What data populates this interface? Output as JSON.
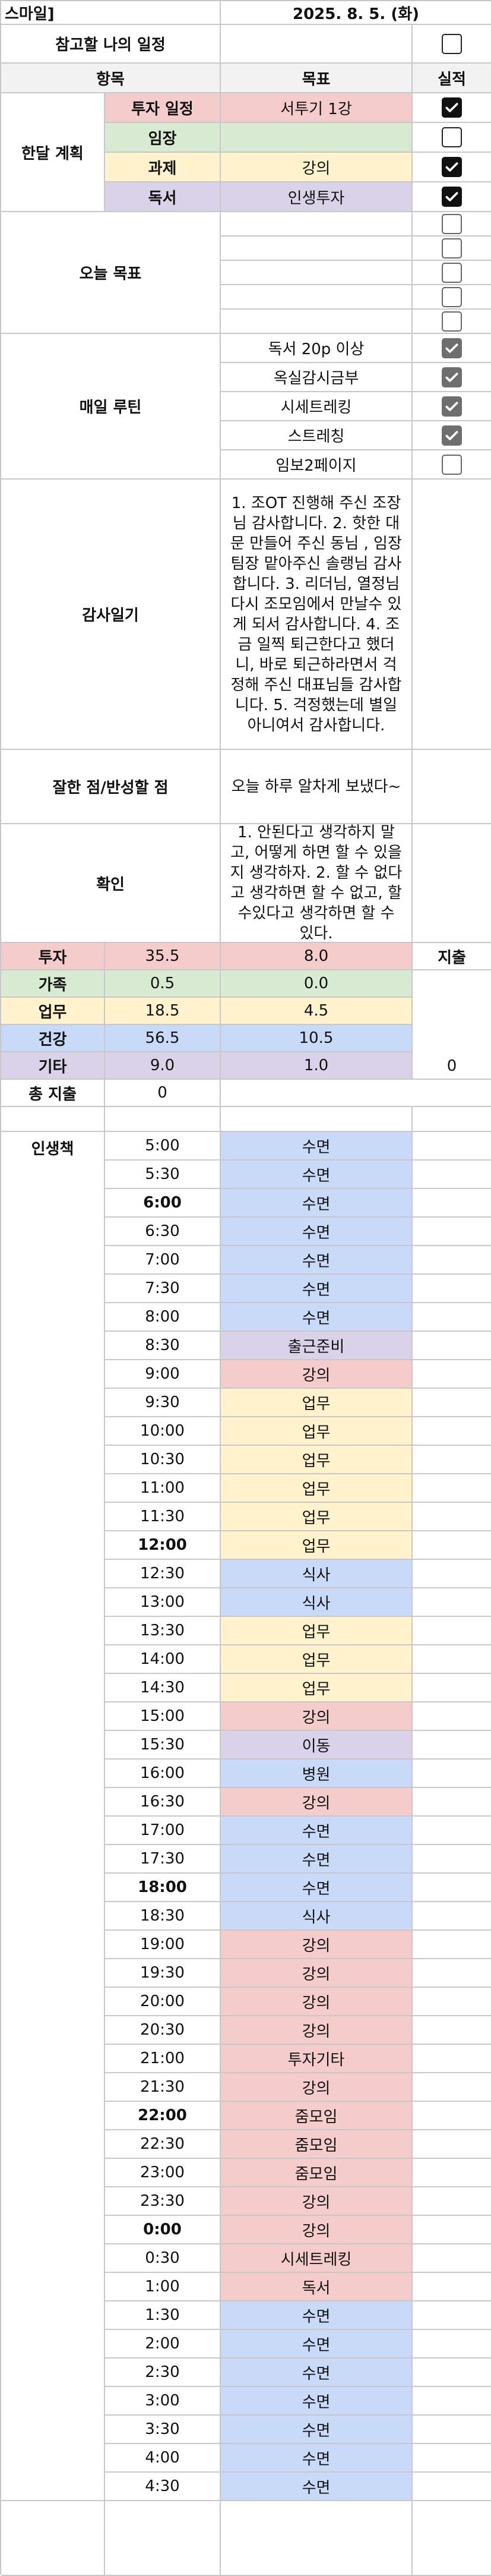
{
  "header": {
    "left_text": "스마일]",
    "date": "2025. 8. 5. (화)"
  },
  "ref_label": "참고할 나의 일정",
  "col_headers": {
    "item": "항목",
    "goal": "목표",
    "actual": "실적"
  },
  "monthly": {
    "label": "한달 계획",
    "rows": [
      {
        "label": "투자 일정",
        "goal": "서투기 1강",
        "checked": true
      },
      {
        "label": "임장",
        "goal": "",
        "checked": false
      },
      {
        "label": "과제",
        "goal": "강의",
        "checked": true
      },
      {
        "label": "독서",
        "goal": "인생투자",
        "checked": true
      }
    ]
  },
  "today_goal": {
    "label": "오늘 목표",
    "rows": 5
  },
  "routine": {
    "label": "매일 루틴",
    "items": [
      {
        "text": "독서 20p 이상",
        "checked": true
      },
      {
        "text": "옥실감시금부",
        "checked": true
      },
      {
        "text": "시세트레킹",
        "checked": true
      },
      {
        "text": "스트레칭",
        "checked": true
      },
      {
        "text": "임보2페이지",
        "checked": false
      }
    ]
  },
  "gratitude": {
    "label": "감사일기",
    "text": "1. 조OT 진행해 주신 조장님 감사합니다. 2. 핫한 대문 만들어 주신 동님 , 임장팀장 맡아주신 솔랭님 감사합니다.  3. 리더님, 열정님 다시 조모임에서 만날수 있게 되서 감사합니다.  4. 조금 일찍 퇴근한다고 했더니, 바로 퇴근하라면서 걱정해 주신 대표님들 감사합니다.  5. 걱정했는데 별일 아니여서 감사합니다."
  },
  "reflection": {
    "label": "잘한 점/반성할 점",
    "text": "오늘 하루 알차게 보냈다~"
  },
  "confirm": {
    "label": "확인",
    "text": "1. 안된다고 생각하지 말고, 어떻게 하면 할 수 있을지 생각하자. 2. 할 수 없다고 생각하면 할 수 없고, 할 수있다고 생각하면 할 수 있다."
  },
  "summary": {
    "rows": [
      {
        "label": "투자",
        "a": "35.5",
        "b": "8.0",
        "color": "#f4cccc"
      },
      {
        "label": "가족",
        "a": "0.5",
        "b": "0.0",
        "color": "#d9ead3"
      },
      {
        "label": "업무",
        "a": "18.5",
        "b": "4.5",
        "color": "#fff2cc"
      },
      {
        "label": "건강",
        "a": "56.5",
        "b": "10.5",
        "color": "#c9daf8"
      },
      {
        "label": "기타",
        "a": "9.0",
        "b": "1.0",
        "color": "#d9d2e9"
      }
    ],
    "expense_label": "지출",
    "expense_value": "0",
    "total_label": "총 지출",
    "total_value": "0"
  },
  "schedule": {
    "label": "인생책",
    "rows": [
      {
        "t": "5:00",
        "a": "수면",
        "c": "#c9daf8"
      },
      {
        "t": "5:30",
        "a": "수면",
        "c": "#c9daf8"
      },
      {
        "t": "6:00",
        "a": "수면",
        "c": "#c9daf8",
        "bold": true
      },
      {
        "t": "6:30",
        "a": "수면",
        "c": "#c9daf8"
      },
      {
        "t": "7:00",
        "a": "수면",
        "c": "#c9daf8"
      },
      {
        "t": "7:30",
        "a": "수면",
        "c": "#c9daf8"
      },
      {
        "t": "8:00",
        "a": "수면",
        "c": "#c9daf8"
      },
      {
        "t": "8:30",
        "a": "출근준비",
        "c": "#d9d2e9"
      },
      {
        "t": "9:00",
        "a": "강의",
        "c": "#f4cccc"
      },
      {
        "t": "9:30",
        "a": "업무",
        "c": "#fff2cc"
      },
      {
        "t": "10:00",
        "a": "업무",
        "c": "#fff2cc"
      },
      {
        "t": "10:30",
        "a": "업무",
        "c": "#fff2cc"
      },
      {
        "t": "11:00",
        "a": "업무",
        "c": "#fff2cc"
      },
      {
        "t": "11:30",
        "a": "업무",
        "c": "#fff2cc"
      },
      {
        "t": "12:00",
        "a": "업무",
        "c": "#fff2cc",
        "bold": true
      },
      {
        "t": "12:30",
        "a": "식사",
        "c": "#c9daf8"
      },
      {
        "t": "13:00",
        "a": "식사",
        "c": "#c9daf8"
      },
      {
        "t": "13:30",
        "a": "업무",
        "c": "#fff2cc"
      },
      {
        "t": "14:00",
        "a": "업무",
        "c": "#fff2cc"
      },
      {
        "t": "14:30",
        "a": "업무",
        "c": "#fff2cc"
      },
      {
        "t": "15:00",
        "a": "강의",
        "c": "#f4cccc"
      },
      {
        "t": "15:30",
        "a": "이동",
        "c": "#d9d2e9"
      },
      {
        "t": "16:00",
        "a": "병원",
        "c": "#c9daf8"
      },
      {
        "t": "16:30",
        "a": "강의",
        "c": "#f4cccc"
      },
      {
        "t": "17:00",
        "a": "수면",
        "c": "#c9daf8"
      },
      {
        "t": "17:30",
        "a": "수면",
        "c": "#c9daf8"
      },
      {
        "t": "18:00",
        "a": "수면",
        "c": "#c9daf8",
        "bold": true
      },
      {
        "t": "18:30",
        "a": "식사",
        "c": "#c9daf8"
      },
      {
        "t": "19:00",
        "a": "강의",
        "c": "#f4cccc"
      },
      {
        "t": "19:30",
        "a": "강의",
        "c": "#f4cccc"
      },
      {
        "t": "20:00",
        "a": "강의",
        "c": "#f4cccc"
      },
      {
        "t": "20:30",
        "a": "강의",
        "c": "#f4cccc"
      },
      {
        "t": "21:00",
        "a": "투자기타",
        "c": "#f4cccc"
      },
      {
        "t": "21:30",
        "a": "강의",
        "c": "#f4cccc"
      },
      {
        "t": "22:00",
        "a": "줌모임",
        "c": "#f4cccc",
        "bold": true
      },
      {
        "t": "22:30",
        "a": "줌모임",
        "c": "#f4cccc"
      },
      {
        "t": "23:00",
        "a": "줌모임",
        "c": "#f4cccc"
      },
      {
        "t": "23:30",
        "a": "강의",
        "c": "#f4cccc"
      },
      {
        "t": "0:00",
        "a": "강의",
        "c": "#f4cccc",
        "bold": true
      },
      {
        "t": "0:30",
        "a": "시세트레킹",
        "c": "#f4cccc"
      },
      {
        "t": "1:00",
        "a": "독서",
        "c": "#f4cccc"
      },
      {
        "t": "1:30",
        "a": "수면",
        "c": "#c9daf8"
      },
      {
        "t": "2:00",
        "a": "수면",
        "c": "#c9daf8"
      },
      {
        "t": "2:30",
        "a": "수면",
        "c": "#c9daf8"
      },
      {
        "t": "3:00",
        "a": "수면",
        "c": "#c9daf8"
      },
      {
        "t": "3:30",
        "a": "수면",
        "c": "#c9daf8"
      },
      {
        "t": "4:00",
        "a": "수면",
        "c": "#c9daf8"
      },
      {
        "t": "4:30",
        "a": "수면",
        "c": "#c9daf8"
      }
    ]
  },
  "colors": {
    "item_header_bg": "#f2f2f2",
    "invest_bg": "#f4cccc",
    "imjang_bg": "#d9ead3",
    "task_bg": "#fff2cc",
    "reading_bg": "#d9d2e9"
  }
}
